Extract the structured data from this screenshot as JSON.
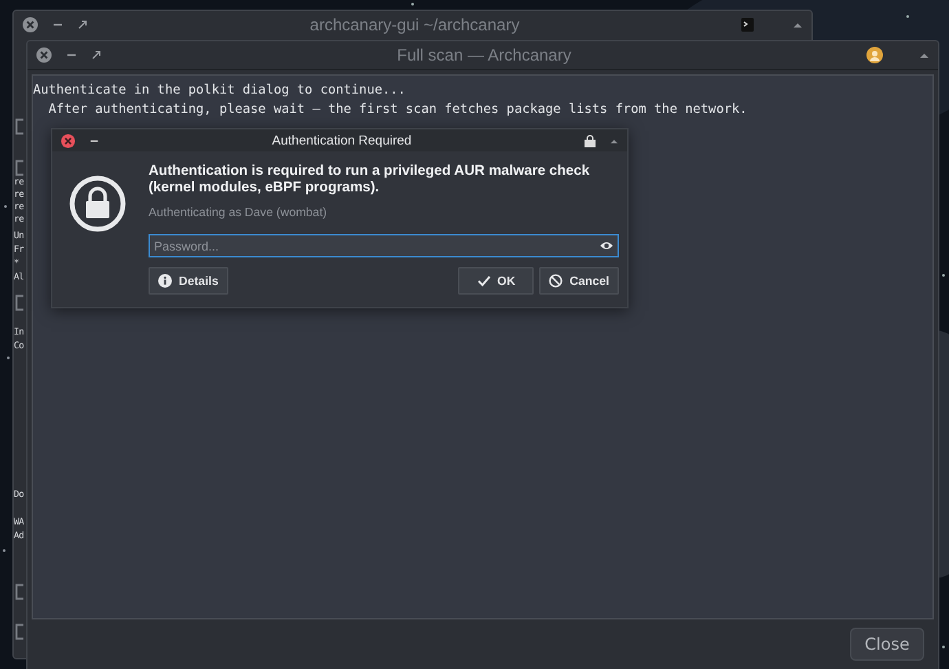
{
  "back_window": {
    "title": "archcanary-gui ~/archcanary",
    "edge_lines": [
      "re",
      "re",
      "re",
      "re",
      "Un",
      "Fr",
      "*",
      "Al",
      "In",
      "Co",
      "Do",
      "WA",
      "Ad"
    ]
  },
  "scan_window": {
    "title": "Full scan — Archcanary",
    "output": [
      "Authenticate in the polkit dialog to continue...",
      "  After authenticating, please wait — the first scan fetches package lists from the network."
    ],
    "close_button": "Close"
  },
  "auth_dialog": {
    "title": "Authentication Required",
    "message": "Authentication is required to run a privileged AUR malware check (kernel modules, eBPF programs).",
    "identity": "Authenticating as Dave (wombat)",
    "password": {
      "placeholder": "Password..."
    },
    "buttons": [
      {
        "kind": "details",
        "label": "Details"
      },
      {
        "kind": "ok",
        "label": "OK"
      },
      {
        "kind": "cancel",
        "label": "Cancel"
      }
    ]
  }
}
